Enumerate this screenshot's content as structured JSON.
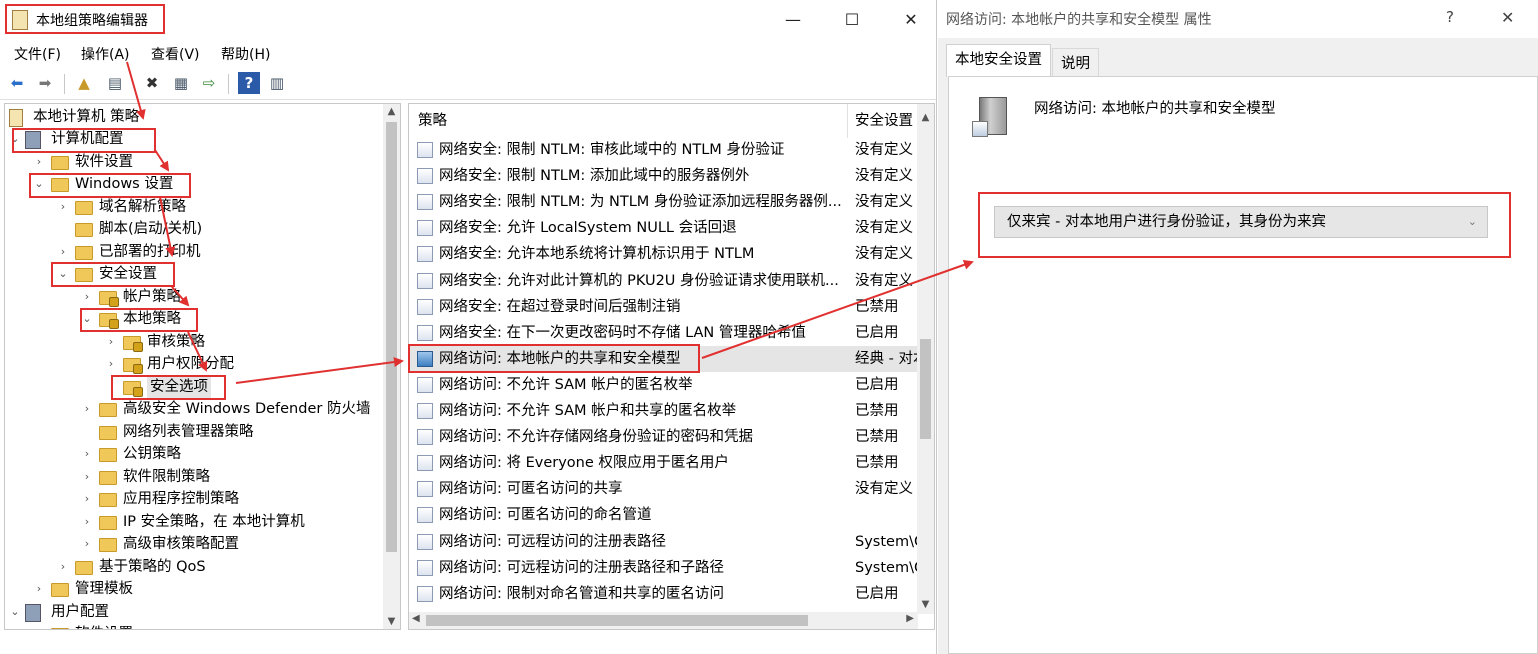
{
  "main_window": {
    "title": "本地组策略编辑器",
    "controls": {
      "minimize": "—",
      "maximize": "☐",
      "close": "✕"
    },
    "menu": [
      "文件(F)",
      "操作(A)",
      "查看(V)",
      "帮助(H)"
    ]
  },
  "tree": {
    "root": "本地计算机 策略",
    "items": [
      {
        "label": "计算机配置",
        "level": 1,
        "expanded": true
      },
      {
        "label": "软件设置",
        "level": 2,
        "expanded": false
      },
      {
        "label": "Windows 设置",
        "level": 2,
        "expanded": true
      },
      {
        "label": "域名解析策略",
        "level": 3,
        "expanded": false
      },
      {
        "label": "脚本(启动/关机)",
        "level": 3
      },
      {
        "label": "已部署的打印机",
        "level": 3,
        "expanded": false
      },
      {
        "label": "安全设置",
        "level": 3,
        "expanded": true
      },
      {
        "label": "帐户策略",
        "level": 4,
        "expanded": false
      },
      {
        "label": "本地策略",
        "level": 4,
        "expanded": true
      },
      {
        "label": "审核策略",
        "level": 5,
        "expanded": false
      },
      {
        "label": "用户权限分配",
        "level": 5,
        "expanded": false
      },
      {
        "label": "安全选项",
        "level": 5,
        "selected": true
      },
      {
        "label": "高级安全 Windows Defender 防火墙",
        "level": 4,
        "expanded": false
      },
      {
        "label": "网络列表管理器策略",
        "level": 4
      },
      {
        "label": "公钥策略",
        "level": 4,
        "expanded": false
      },
      {
        "label": "软件限制策略",
        "level": 4,
        "expanded": false
      },
      {
        "label": "应用程序控制策略",
        "level": 4,
        "expanded": false
      },
      {
        "label": "IP 安全策略，在 本地计算机",
        "level": 4,
        "expanded": false
      },
      {
        "label": "高级审核策略配置",
        "level": 4,
        "expanded": false
      },
      {
        "label": "基于策略的 QoS",
        "level": 3,
        "expanded": false
      },
      {
        "label": "管理模板",
        "level": 2,
        "expanded": false
      },
      {
        "label": "用户配置",
        "level": 1,
        "expanded": true
      },
      {
        "label": "软件设置",
        "level": 2
      }
    ]
  },
  "list": {
    "columns": [
      "策略",
      "安全设置"
    ],
    "rows": [
      {
        "name": "网络安全: 限制 NTLM: 审核此域中的 NTLM 身份验证",
        "value": "没有定义"
      },
      {
        "name": "网络安全: 限制 NTLM: 添加此域中的服务器例外",
        "value": "没有定义"
      },
      {
        "name": "网络安全: 限制 NTLM: 为 NTLM 身份验证添加远程服务器例...",
        "value": "没有定义"
      },
      {
        "name": "网络安全: 允许 LocalSystem NULL 会话回退",
        "value": "没有定义"
      },
      {
        "name": "网络安全: 允许本地系统将计算机标识用于 NTLM",
        "value": "没有定义"
      },
      {
        "name": "网络安全: 允许对此计算机的 PKU2U 身份验证请求使用联机...",
        "value": "没有定义"
      },
      {
        "name": "网络安全: 在超过登录时间后强制注销",
        "value": "已禁用"
      },
      {
        "name": "网络安全: 在下一次更改密码时不存储 LAN 管理器哈希值",
        "value": "已启用"
      },
      {
        "name": "网络访问: 本地帐户的共享和安全模型",
        "value": "经典 - 对本",
        "selected": true
      },
      {
        "name": "网络访问: 不允许 SAM 帐户的匿名枚举",
        "value": "已启用"
      },
      {
        "name": "网络访问: 不允许 SAM 帐户和共享的匿名枚举",
        "value": "已禁用"
      },
      {
        "name": "网络访问: 不允许存储网络身份验证的密码和凭据",
        "value": "已禁用"
      },
      {
        "name": "网络访问: 将 Everyone 权限应用于匿名用户",
        "value": "已禁用"
      },
      {
        "name": "网络访问: 可匿名访问的共享",
        "value": "没有定义"
      },
      {
        "name": "网络访问: 可匿名访问的命名管道",
        "value": ""
      },
      {
        "name": "网络访问: 可远程访问的注册表路径",
        "value": "System\\Cu"
      },
      {
        "name": "网络访问: 可远程访问的注册表路径和子路径",
        "value": "System\\Cu"
      },
      {
        "name": "网络访问: 限制对命名管道和共享的匿名访问",
        "value": "已启用"
      }
    ]
  },
  "props_window": {
    "title": "网络访问: 本地帐户的共享和安全模型 属性",
    "help": "?",
    "close": "✕",
    "tabs": [
      "本地安全设置",
      "说明"
    ],
    "policy_title": "网络访问: 本地帐户的共享和安全模型",
    "dropdown_value": "仅来宾 - 对本地用户进行身份验证，其身份为来宾"
  },
  "colors": {
    "annotation": "#e03030",
    "selection": "#e5e5e5"
  }
}
